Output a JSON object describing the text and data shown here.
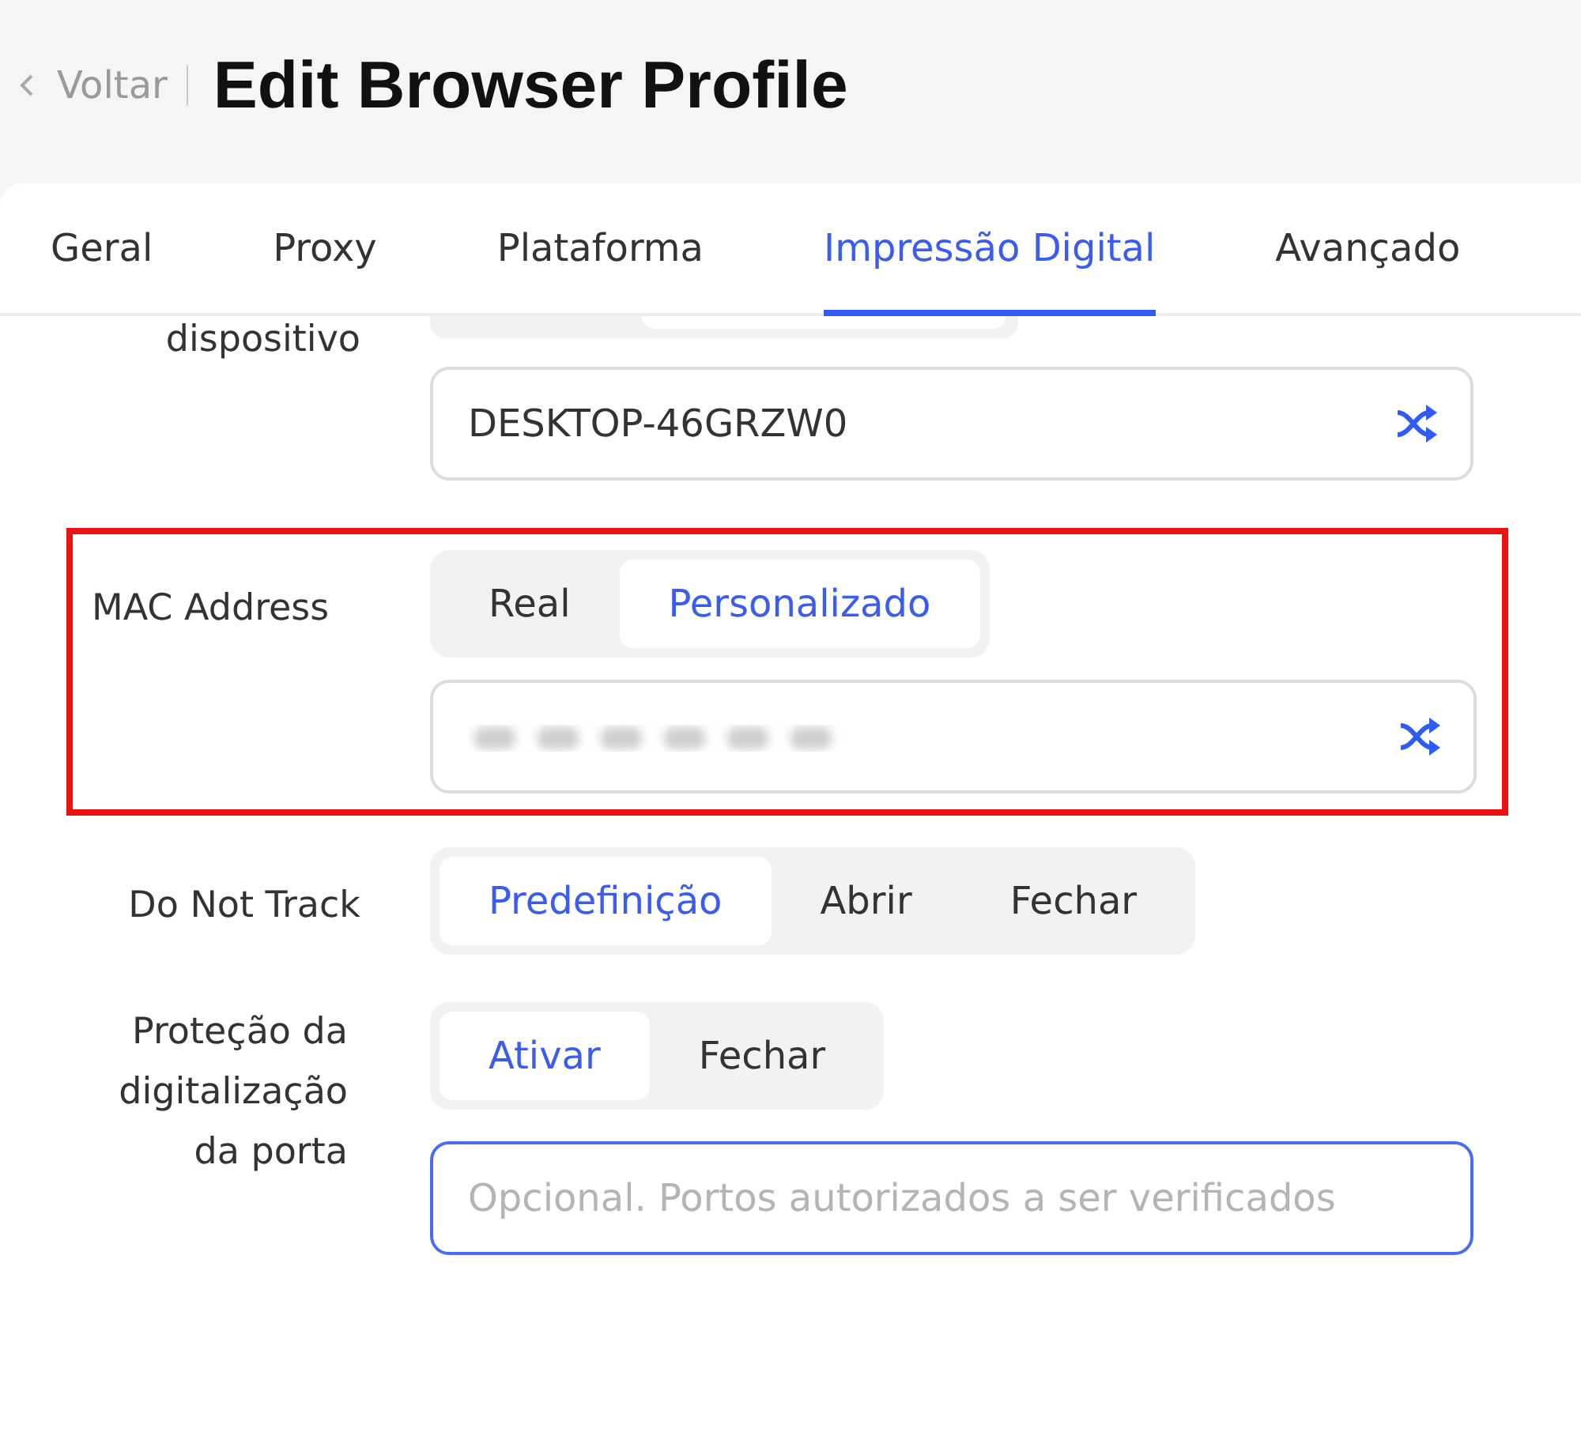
{
  "header": {
    "back_label": "Voltar",
    "title": "Edit Browser Profile"
  },
  "tabs": [
    {
      "label": "Geral",
      "selected": false
    },
    {
      "label": "Proxy",
      "selected": false
    },
    {
      "label": "Plataforma",
      "selected": false
    },
    {
      "label": "Impressão Digital",
      "selected": true
    },
    {
      "label": "Avançado",
      "selected": false
    }
  ],
  "cut_label": "dispositivo",
  "device_name": {
    "value": "DESKTOP-46GRZW0"
  },
  "mac": {
    "label": "MAC Address",
    "highlighted": true,
    "options": [
      {
        "label": "Real",
        "selected": false
      },
      {
        "label": "Personalizado",
        "selected": true
      }
    ],
    "value_blurred": true
  },
  "dnt": {
    "label": "Do Not Track",
    "options": [
      {
        "label": "Predefinição",
        "selected": true
      },
      {
        "label": "Abrir",
        "selected": false
      },
      {
        "label": "Fechar",
        "selected": false
      }
    ]
  },
  "port": {
    "label": "Proteção da digitalização da porta",
    "options": [
      {
        "label": "Ativar",
        "selected": true
      },
      {
        "label": "Fechar",
        "selected": false
      }
    ],
    "placeholder": "Opcional. Portos autorizados a ser verificados"
  }
}
